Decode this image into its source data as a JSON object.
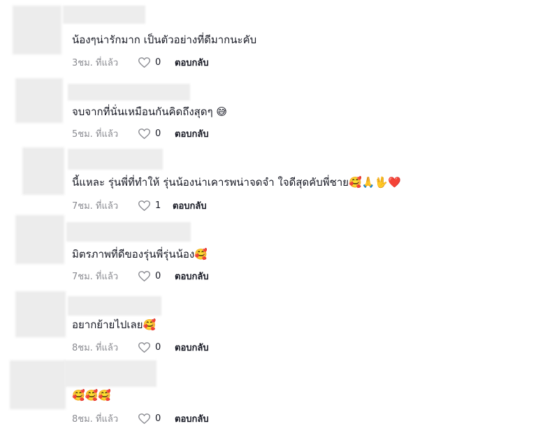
{
  "comments": [
    {
      "text": "น้องๆน่ารักมาก เป็นตัวอย่างที่ดีมากนะคับ",
      "time": "3ชม. ที่แล้ว",
      "likes": "0",
      "reply": "ตอบกลับ"
    },
    {
      "text": "จบจากที่นั่นเหมือนกันคิดถึงสุดๆ 😅",
      "time": "5ชม. ที่แล้ว",
      "likes": "0",
      "reply": "ตอบกลับ"
    },
    {
      "text": "นี้แหละ รุ่นพี่ที่ทำให้ รุ่นน้องน่าเคารพน่าจดจำ ใจดีสุดคับพี่ชาย🥰🙏🖖❤️",
      "time": "7ชม. ที่แล้ว",
      "likes": "1",
      "reply": "ตอบกลับ"
    },
    {
      "text": "มิตรภาพที่ดีของรุ่นพี่รุ่นน้อง🥰",
      "time": "7ชม. ที่แล้ว",
      "likes": "0",
      "reply": "ตอบกลับ"
    },
    {
      "text": "อยากย้ายไปเลย🥰",
      "time": "8ชม. ที่แล้ว",
      "likes": "0",
      "reply": "ตอบกลับ"
    },
    {
      "text": "🥰🥰🥰",
      "time": "8ชม. ที่แล้ว",
      "likes": "0",
      "reply": "ตอบกลับ"
    }
  ],
  "icons": {
    "like": "heart-outline-icon"
  },
  "colors": {
    "meta": "#8a8b91",
    "text": "#161823"
  }
}
